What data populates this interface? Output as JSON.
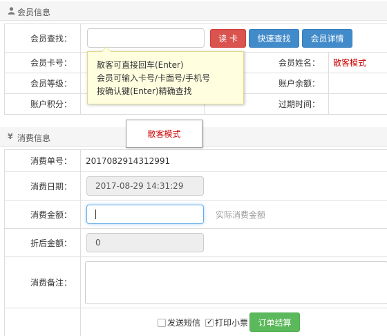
{
  "member_panel": {
    "title": "会员信息",
    "icon": "user-icon",
    "search_label": "会员查找：",
    "search_value": "",
    "buttons": {
      "read_card": "读 卡",
      "quick_search": "快速查找",
      "member_detail": "会员详情"
    },
    "card_no_label": "会员卡号：",
    "level_label": "会员等级：",
    "points_label": "账户积分：",
    "name_label": "会员姓名：",
    "name_value": "散客模式",
    "balance_label": "账户余额：",
    "expire_label": "过期时间："
  },
  "tooltip": {
    "line1": "散客可直接回车(Enter)",
    "line2": "会员可输入卡号/卡面号/手机号",
    "line3": "按确认键(Enter)精确查找"
  },
  "popup": {
    "text": "散客模式"
  },
  "consume_panel": {
    "title": "消费信息",
    "icon": "yen-icon",
    "order_no_label": "消费单号：",
    "order_no_value": "2017082914312991",
    "date_label": "消费日期：",
    "date_value": "2017-08-29 14:31:29",
    "amount_label": "消费金额：",
    "amount_value": "",
    "amount_hint": "实际消费金额",
    "discount_label": "折后金额：",
    "discount_value": "0",
    "remark_label": "消费备注：",
    "remark_value": "",
    "sms_label": "发送短信",
    "sms_checked": false,
    "print_label": "打印小票",
    "print_checked": true,
    "settle_button": "订单结算"
  }
}
